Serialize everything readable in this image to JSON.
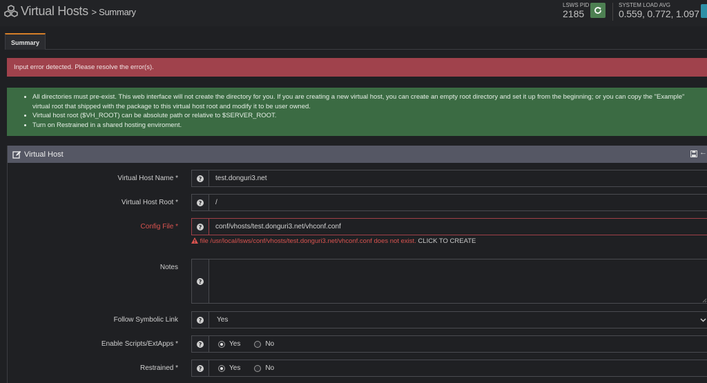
{
  "header": {
    "title": "Virtual Hosts",
    "breadcrumb": "> Summary",
    "pid_label": "LSWS PID",
    "pid_value": "2185",
    "load_label": "SYSTEM LOAD AVG",
    "load_value": "0.559, 0.772, 1.097"
  },
  "tabs": [
    {
      "label": "Summary",
      "active": true
    }
  ],
  "error_banner": "Input error detected. Please resolve the error(s).",
  "info_items": [
    "All directories must pre-exist. This web interface will not create the directory for you. If you are creating a new virtual host, you can create an empty root directory and set it up from the beginning; or you can copy the \"Example\" virtual root that shipped with the package to this virtual host root and modify it to be user owned.",
    "Virtual host root ($VH_ROOT) can be absolute path or relative to $SERVER_ROOT.",
    "Turn on Restrained in a shared hosting enviroment."
  ],
  "panel": {
    "title": "Virtual Host",
    "fields": {
      "vh_name": {
        "label": "Virtual Host Name *",
        "value": "test.donguri3.net"
      },
      "vh_root": {
        "label": "Virtual Host Root *",
        "value": "/"
      },
      "config_file": {
        "label": "Config File *",
        "value": "conf/vhosts/test.donguri3.net/vhconf.conf",
        "error": "file /usr/local/lsws/conf/vhosts/test.donguri3.net/vhconf.conf does not exist.",
        "create": "CLICK TO CREATE"
      },
      "notes": {
        "label": "Notes",
        "value": ""
      },
      "follow_symlink": {
        "label": "Follow Symbolic Link",
        "value": "Yes"
      },
      "enable_scripts": {
        "label": "Enable Scripts/ExtApps *",
        "yes": "Yes",
        "no": "No",
        "selected": "Yes"
      },
      "restrained": {
        "label": "Restrained *",
        "yes": "Yes",
        "no": "No",
        "selected": "Yes"
      }
    }
  },
  "colors": {
    "error_banner_bg": "#a0424c",
    "info_bg": "#3b6b43",
    "panel_header_bg": "#555764",
    "tab_accent": "#d67f28",
    "error_text": "#d9534f",
    "restart_btn": "#4d8052"
  },
  "icons": [
    "cubes-icon",
    "refresh-icon",
    "edit-icon",
    "save-icon",
    "question-circle-icon",
    "warning-icon",
    "chevron-down-icon"
  ]
}
